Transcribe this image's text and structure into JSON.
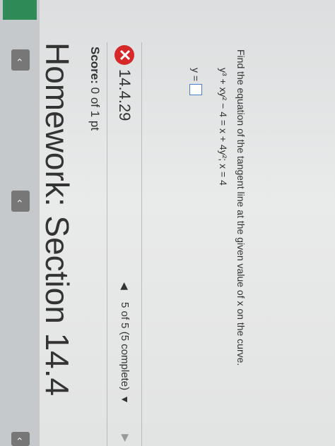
{
  "header": {
    "title": "Homework: Section 14.4"
  },
  "score": {
    "label": "Score:",
    "value": "0 of 1 pt"
  },
  "question": {
    "number": "14.4.29",
    "status_icon": "x-icon",
    "pager_text": "5 of 5 (5 complete)",
    "prompt": "Find the equation of the tangent line at the given value of x on the curve.",
    "equation": "y³ + xy² − 4 = x + 4y²;  x = 4",
    "answer_label": "y ="
  },
  "colors": {
    "error": "#d62828",
    "input_border": "#4a7fd0"
  }
}
